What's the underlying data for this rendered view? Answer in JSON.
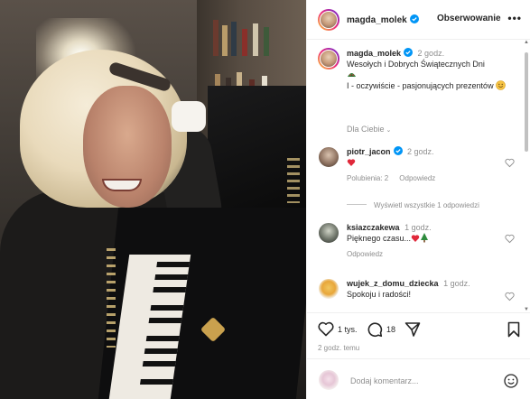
{
  "header": {
    "username": "magda_molek",
    "follow_label": "Obserwowanie",
    "more_label": "•••"
  },
  "caption": {
    "username": "magda_molek",
    "time": "2 godz.",
    "line1": "Wesołych i Dobrych Świątecznych Dni",
    "line2": "I - oczywiście - pasjonujących prezentów"
  },
  "filter": {
    "label": "Dla Ciebie"
  },
  "comments": [
    {
      "username": "piotr_jacon",
      "time": "2 godz.",
      "text": "",
      "likes_label": "Polubienia: 2",
      "reply_label": "Odpowiedz",
      "view_replies": "Wyświetl wszystkie 1 odpowiedzi"
    },
    {
      "username": "ksiazczakewa",
      "time": "1 godz.",
      "text": "Pięknego czasu...",
      "reply_label": "Odpowiedz"
    },
    {
      "username": "wujek_z_domu_dziecka",
      "time": "1 godz.",
      "text": "Spokoju i radości!"
    }
  ],
  "actions": {
    "likes": "1 tys.",
    "comments": "18",
    "post_time": "2 godz. temu"
  },
  "add_comment": {
    "placeholder": "Dodaj komentarz..."
  },
  "colors": {
    "verified": "#0095f6",
    "heart_red": "#ed4956",
    "tree_green": "#2e8b3d"
  },
  "icons": [
    "verified-icon",
    "heart-icon",
    "comment-icon",
    "share-icon",
    "bookmark-icon",
    "smiley-icon",
    "more-icon",
    "chevron-down-icon"
  ]
}
